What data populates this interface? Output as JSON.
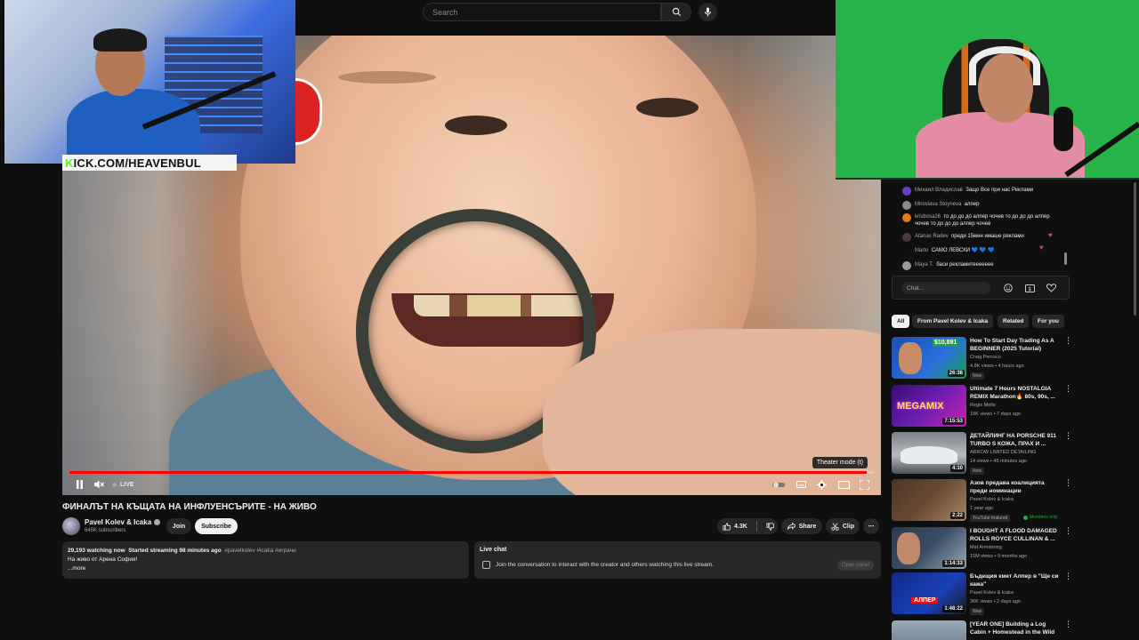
{
  "search": {
    "placeholder": "Search"
  },
  "overlay": {
    "kick_prefix": "K",
    "kick_rest": "ICK.COM/HEAVENBUL"
  },
  "player": {
    "live_label": "LIVE",
    "tooltip": "Theater mode (t)",
    "progress": 0.99
  },
  "video": {
    "title": "ФИНАЛЪТ НА КЪЩАТА НА ИНФЛУЕНСЪРИТЕ - НА ЖИВО",
    "channel": "Pavel Kolev & Icaka",
    "subscribers": "645K subscribers",
    "join_label": "Join",
    "subscribe_label": "Subscribe",
    "likes": "4.3K",
    "share_label": "Share",
    "clip_label": "Clip",
    "more_label": "⋯"
  },
  "description": {
    "watching": "29,193 watching now",
    "started": "Started streaming 98 minutes ago",
    "tags": "#pavelkolev #icaka #играчи",
    "line2": "На живо от Арена София!",
    "more": "...more"
  },
  "livechat_box": {
    "title": "Live chat",
    "message": "Join the conversation to interact with the creator and others watching this live stream.",
    "open_panel": "Open panel"
  },
  "chat": {
    "messages": [
      {
        "name": "Михаил Владислав",
        "text": "Защо Все при нас Реклами",
        "color": "#6a3fc7"
      },
      {
        "name": "Miroslava Stoyneva",
        "text": "алпер",
        "color": "#8a8a8a"
      },
      {
        "name": "krisbosa26",
        "text": "то до до до алпер чочев то до до до алпер чочев то до до до алпер чочев",
        "color": "#e07b1a"
      },
      {
        "name": "Atanas Radev",
        "text": "преди 15мин имаше реклами",
        "color": "#4a3b3b"
      },
      {
        "name": "Marto",
        "text": "САМО ЛЕВСКИ 💙 💙 💙",
        "color": "#111111"
      },
      {
        "name": "Maya T.",
        "text": "баси рекламитеееееее",
        "color": "#9a9a9a"
      }
    ],
    "input_placeholder": "Chat..."
  },
  "chips": [
    "All",
    "From Pavel Kolev & Icaka",
    "Related",
    "For you"
  ],
  "recommendations": [
    {
      "title": "How To Start Day Trading As A BEGINNER (2025 Tutorial)",
      "channel": "Craig Percoco",
      "meta": "4.8K views • 4 hours ago",
      "badge": "New",
      "duration": "26:38",
      "thumb_color": "#2a6fdc",
      "thumb_accent": "#39d353",
      "thumb_text": "$10,891"
    },
    {
      "title": "Ultimate 7 Hours NOSTALGIA REMIX Marathon🔥 80s, 90s, ...",
      "channel": "Regis Mello",
      "meta": "19K views • 7 days ago",
      "badge": "",
      "duration": "7:15:53",
      "thumb_color": "#6a1fb0",
      "thumb_accent": "#ff3fd6",
      "thumb_text": "MEGAMIX"
    },
    {
      "title": "ДЕТАЙЛИНГ НА PORSCHE 911 TURBO S КОЖА, ПРАХ И ...",
      "channel": "ARROW LIMITED DETAILING",
      "meta": "14 views • 45 minutes ago",
      "badge": "New",
      "duration": "4:10",
      "thumb_color": "#9ea3a8",
      "thumb_accent": "#eeeeee",
      "thumb_text": ""
    },
    {
      "title": "Азов предава коалицията преди номинации",
      "channel": "Pavel Kolev & Icaka",
      "meta": "1 year ago",
      "badge": "YouTube featured",
      "members": "Members only",
      "duration": "2:22",
      "thumb_color": "#6b4a34",
      "thumb_accent": "#c7a27c",
      "thumb_text": ""
    },
    {
      "title": "I BOUGHT A FLOOD DAMAGED ROLLS ROYCE CULLINAN & ...",
      "channel": "Mat Armstrong",
      "meta": "15M views • 9 months ago",
      "badge": "",
      "duration": "1:14:33",
      "thumb_color": "#3a4d66",
      "thumb_accent": "#d9d9d9",
      "thumb_text": ""
    },
    {
      "title": "Бъдещия кмет Алпер в \"Ще си кажа\"",
      "channel": "Pavel Kolev & Icaka",
      "meta": "36K views • 2 days ago",
      "badge": "New",
      "duration": "1:48:22",
      "thumb_color": "#1b3fb8",
      "thumb_accent": "#ff2a2a",
      "thumb_text": "АЛПЕР"
    },
    {
      "title": "[YEAR ONE] Building a Log Cabin + Homestead in the Wild",
      "channel": "",
      "meta": "",
      "badge": "",
      "duration": "",
      "thumb_color": "#556b7d",
      "thumb_accent": "#aabbcc",
      "thumb_text": ""
    }
  ]
}
